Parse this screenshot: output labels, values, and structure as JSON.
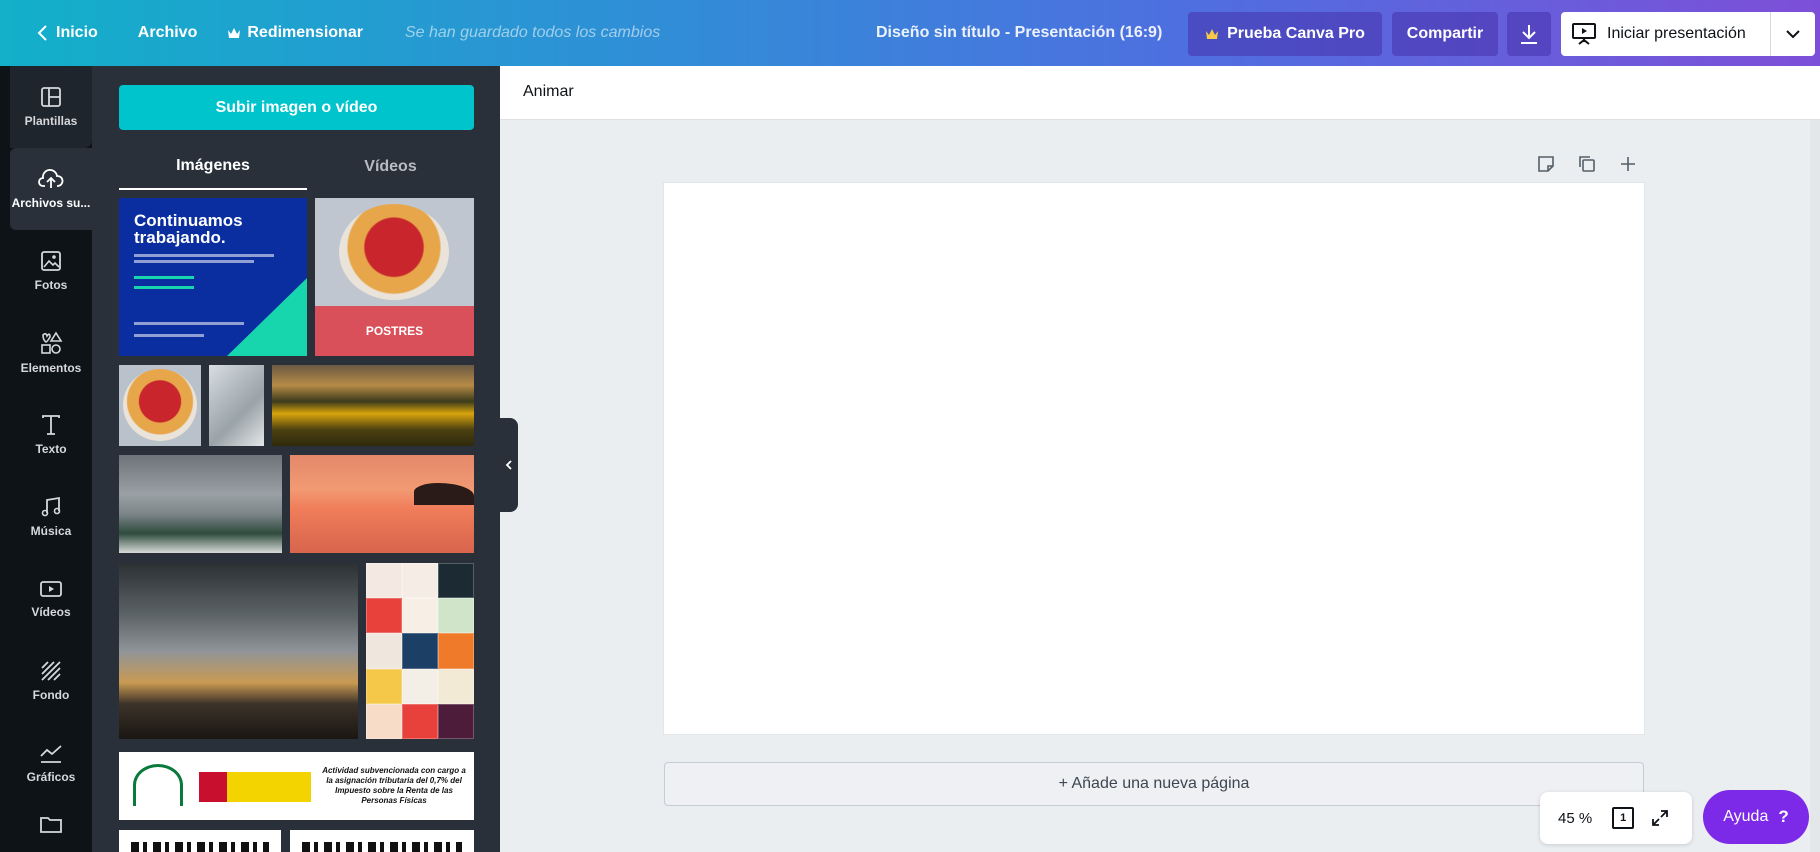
{
  "topbar": {
    "home": "Inicio",
    "file": "Archivo",
    "resize": "Redimensionar",
    "saved_status": "Se han guardado todos los cambios",
    "design_title": "Diseño sin título - Presentación (16:9)",
    "try_pro": "Prueba Canva Pro",
    "share": "Compartir",
    "present": "Iniciar presentación"
  },
  "rail": {
    "items": [
      {
        "label": "Plantillas",
        "icon": "templates-icon"
      },
      {
        "label": "Archivos su...",
        "icon": "upload-cloud-icon"
      },
      {
        "label": "Fotos",
        "icon": "photo-icon"
      },
      {
        "label": "Elementos",
        "icon": "elements-icon"
      },
      {
        "label": "Texto",
        "icon": "text-icon"
      },
      {
        "label": "Música",
        "icon": "music-icon"
      },
      {
        "label": "Vídeos",
        "icon": "video-icon"
      },
      {
        "label": "Fondo",
        "icon": "background-icon"
      },
      {
        "label": "Gráficos",
        "icon": "chart-icon"
      },
      {
        "label": "",
        "icon": "folder-icon"
      }
    ]
  },
  "panel": {
    "upload_button": "Subir imagen o vídeo",
    "tabs": [
      "Imágenes",
      "Vídeos"
    ],
    "thumbs": {
      "blue_heading": "Continuamos trabajando.",
      "tart_label": "POSTRES",
      "junta_text": "Actividad subvencionada con cargo a la asignación tributaria del 0,7% del Impuesto sobre la Renta de las Personas Físicas"
    }
  },
  "workspace": {
    "animate": "Animar",
    "add_page": "+ Añade una nueva página",
    "zoom": "45 %",
    "page_number": "1",
    "help": "Ayuda",
    "help_mark": "?"
  },
  "colors": {
    "accent_teal": "#00c4cc",
    "help_purple": "#7d2ae8",
    "rail_bg": "#0e1318",
    "panel_bg": "#293039"
  }
}
